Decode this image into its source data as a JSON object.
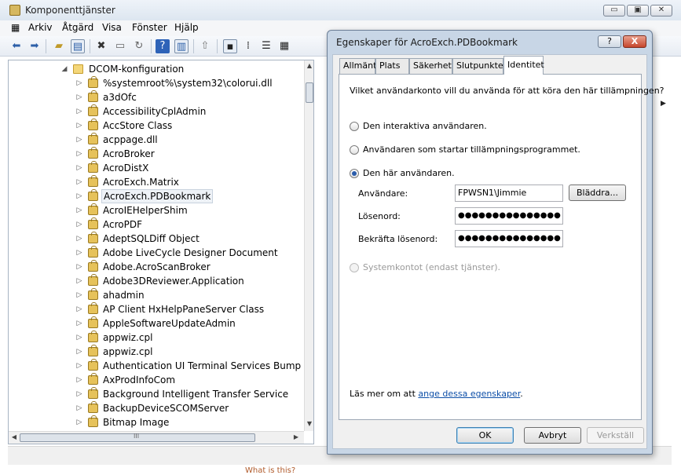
{
  "window": {
    "title": "Komponenttjänster",
    "minimize_label": "▭",
    "maximize_label": "▣",
    "close_label": "✕"
  },
  "menu": [
    "Arkiv",
    "Åtgärd",
    "Visa",
    "Fönster",
    "Hjälp"
  ],
  "toolbar": {
    "icons": [
      "back-arrow-icon",
      "forward-arrow-icon",
      "up-folder-icon",
      "show-hide-tree-icon",
      "delete-icon",
      "properties-icon",
      "refresh-icon",
      "help-icon",
      "console-tree-icon",
      "export-icon",
      "large-icons-view-icon",
      "small-icons-view-icon",
      "list-view-icon",
      "details-view-icon"
    ]
  },
  "tree": {
    "root_label": "DCOM-konfiguration",
    "items": [
      "%systemroot%\\system32\\colorui.dll",
      "a3dOfc",
      "AccessibilityCplAdmin",
      "AccStore Class",
      "acppage.dll",
      "AcroBroker",
      "AcroDistX",
      "AcroExch.Matrix",
      "AcroExch.PDBookmark",
      "AcroIEHelperShim",
      "AcroPDF",
      "AdeptSQLDiff Object",
      "Adobe LiveCycle Designer Document",
      "Adobe.AcroScanBroker",
      "Adobe3DReviewer.Application",
      "ahadmin",
      "AP Client HxHelpPaneServer Class",
      "AppleSoftwareUpdateAdmin",
      "appwiz.cpl",
      "appwiz.cpl",
      "Authentication UI Terminal Services Bump Dialo",
      "AxProdInfoCom",
      "Background Intelligent Transfer Service",
      "BackupDeviceSCOMServer",
      "Bitmap Image"
    ],
    "selected": "AcroExch.PDBookmark",
    "scrollbar": "III"
  },
  "footer_link": "What is this?",
  "dialog": {
    "title": "Egenskaper för AcroExch.PDBookmark",
    "help_button": "?",
    "close_button": "X",
    "tabs": [
      "Allmänt",
      "Plats",
      "Säkerhet",
      "Slutpunkter",
      "Identitet"
    ],
    "active_tab": "Identitet",
    "question": "Vilket användarkonto vill du använda för att köra den här tillämpningen?",
    "options": {
      "interactive": "Den interaktiva användaren.",
      "launching": "Användaren som startar tillämpningsprogrammet.",
      "this_user": "Den här användaren.",
      "system": "Systemkontot (endast tjänster)."
    },
    "selected_option": "this_user",
    "fields": {
      "user_label": "Användare:",
      "user_value": "FPWSN1\\Jimmie",
      "password_label": "Lösenord:",
      "password_value": "●●●●●●●●●●●●●●●",
      "confirm_label": "Bekräfta lösenord:",
      "confirm_value": "●●●●●●●●●●●●●●●"
    },
    "browse_button": "Bläddra...",
    "learn_more_prefix": "Läs mer om att ",
    "learn_more_link": "ange dessa egenskaper",
    "learn_more_suffix": ".",
    "ok_button": "OK",
    "cancel_button": "Avbryt",
    "apply_button": "Verkställ"
  }
}
